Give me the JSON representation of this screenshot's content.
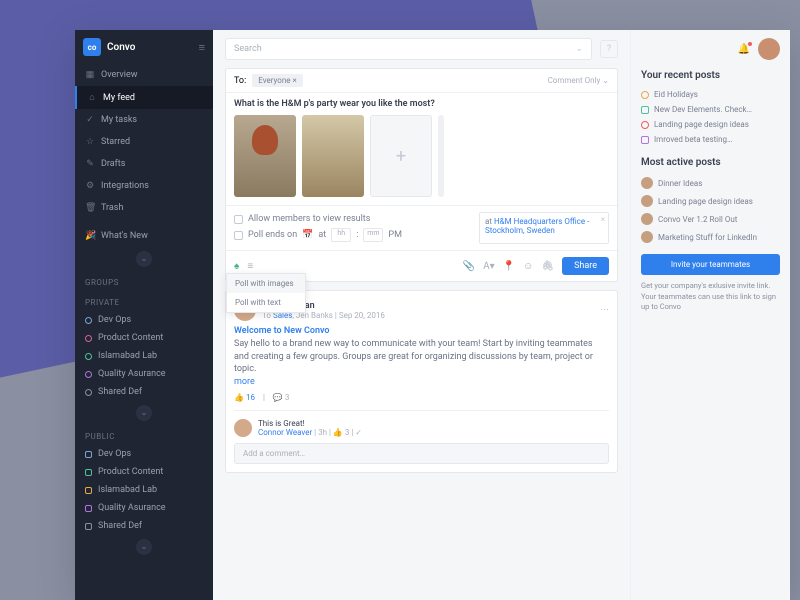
{
  "app": {
    "name": "Convo"
  },
  "nav": [
    {
      "label": "Overview"
    },
    {
      "label": "My feed"
    },
    {
      "label": "My tasks"
    },
    {
      "label": "Starred"
    },
    {
      "label": "Drafts"
    },
    {
      "label": "Integrations"
    },
    {
      "label": "Trash"
    },
    {
      "label": "What's New"
    }
  ],
  "sections": {
    "groups": "GROUPS",
    "private": "PRIVATE",
    "public": "PUBLIC"
  },
  "private": [
    {
      "label": "Dev Ops",
      "c": "#7ea4d6"
    },
    {
      "label": "Product Content",
      "c": "#d75fa3"
    },
    {
      "label": "Islamabad Lab",
      "c": "#4fc29a"
    },
    {
      "label": "Quality Asurance",
      "c": "#b074e0"
    },
    {
      "label": "Shared Def",
      "c": "#8a90a0"
    }
  ],
  "public": [
    {
      "label": "Dev Ops",
      "c": "#7ea4d6"
    },
    {
      "label": "Product Content",
      "c": "#4fc29a"
    },
    {
      "label": "Islamabad Lab",
      "c": "#e6a94f"
    },
    {
      "label": "Quality Asurance",
      "c": "#b074e0"
    },
    {
      "label": "Shared Def",
      "c": "#8a90a0"
    }
  ],
  "search": {
    "placeholder": "Search"
  },
  "composer": {
    "to": "To:",
    "everyone": "Everyone",
    "commentOnly": "Comment Only",
    "question": "What is the H&M p's party wear you like the most?",
    "allow": "Allow members to view results",
    "pollEnds": "Poll ends on",
    "at": "at",
    "hh": "hh",
    "mm": "mm",
    "pm": "PM",
    "locAt": "at ",
    "loc1": "H&M Headquarters Office - ",
    "loc2": "Stockholm, Sweden",
    "share": "Share",
    "dd1": "Poll with images",
    "dd2": "Poll with text"
  },
  "post": {
    "name": "Nina Sullivan",
    "metaTo": "To ",
    "metaSales": "Sales",
    "metaRest": ", Jen Banks  |  Sep 20, 2016",
    "title": "Welcome to New Convo",
    "body": "Say hello to a brand new way to communicate with your team! Start by inviting teammates and creating a few groups. Groups are great for organizing discussions by team, project or topic.",
    "more": "more",
    "likes": "16",
    "comments": "3",
    "replyText": "This is Great!",
    "replyName": "Connor Weaver",
    "replyMeta": " | 3h |",
    "addComment": "Add a comment…"
  },
  "right": {
    "recent": "Your recent posts",
    "r": [
      {
        "t": "Eid Holidays",
        "c": "#e6a94f",
        "s": "ci"
      },
      {
        "t": "New Dev Elements. Check…",
        "c": "#4fc29a",
        "s": "sq"
      },
      {
        "t": "Landing page design ideas",
        "c": "#f25c5c",
        "s": "ci"
      },
      {
        "t": "Imroved beta testing…",
        "c": "#b074e0",
        "s": "sq"
      }
    ],
    "active": "Most active posts",
    "a": [
      "Dinner Ideas",
      "Landing page design ideas",
      "Convo Ver 1.2 Roll Out",
      "Marketing Stuff for LinkedIn"
    ],
    "invite": "Invite your teammates",
    "inviteText": "Get your company's exlusive invite link. Your teammates can use this link to sign up to Convo"
  }
}
